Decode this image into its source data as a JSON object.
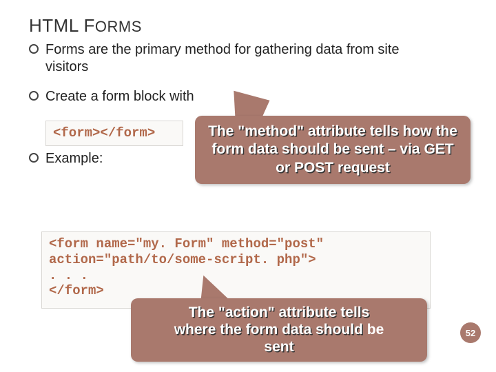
{
  "title_main": "HTML F",
  "title_rest": "ORMS",
  "bullets": {
    "b1": "Forms are the primary method for gathering data from site visitors",
    "b2": "Create a form block with",
    "b3": "Example:"
  },
  "code": {
    "snippet1": "<form></form>",
    "snippet2_l1": "<form name=\"my. Form\" method=\"post\"",
    "snippet2_l2": "action=\"path/to/some-script. php\">",
    "snippet2_l3": "  . . .",
    "snippet2_l4": "</form>"
  },
  "callouts": {
    "method": "The \"method\" attribute tells how the form data should be sent – via GET or POST request",
    "action_l1": "The \"action\" attribute tells",
    "action_l2_a": "where the form data should ",
    "action_l2_b": "be",
    "action_l3": "sent"
  },
  "page_number": "52"
}
